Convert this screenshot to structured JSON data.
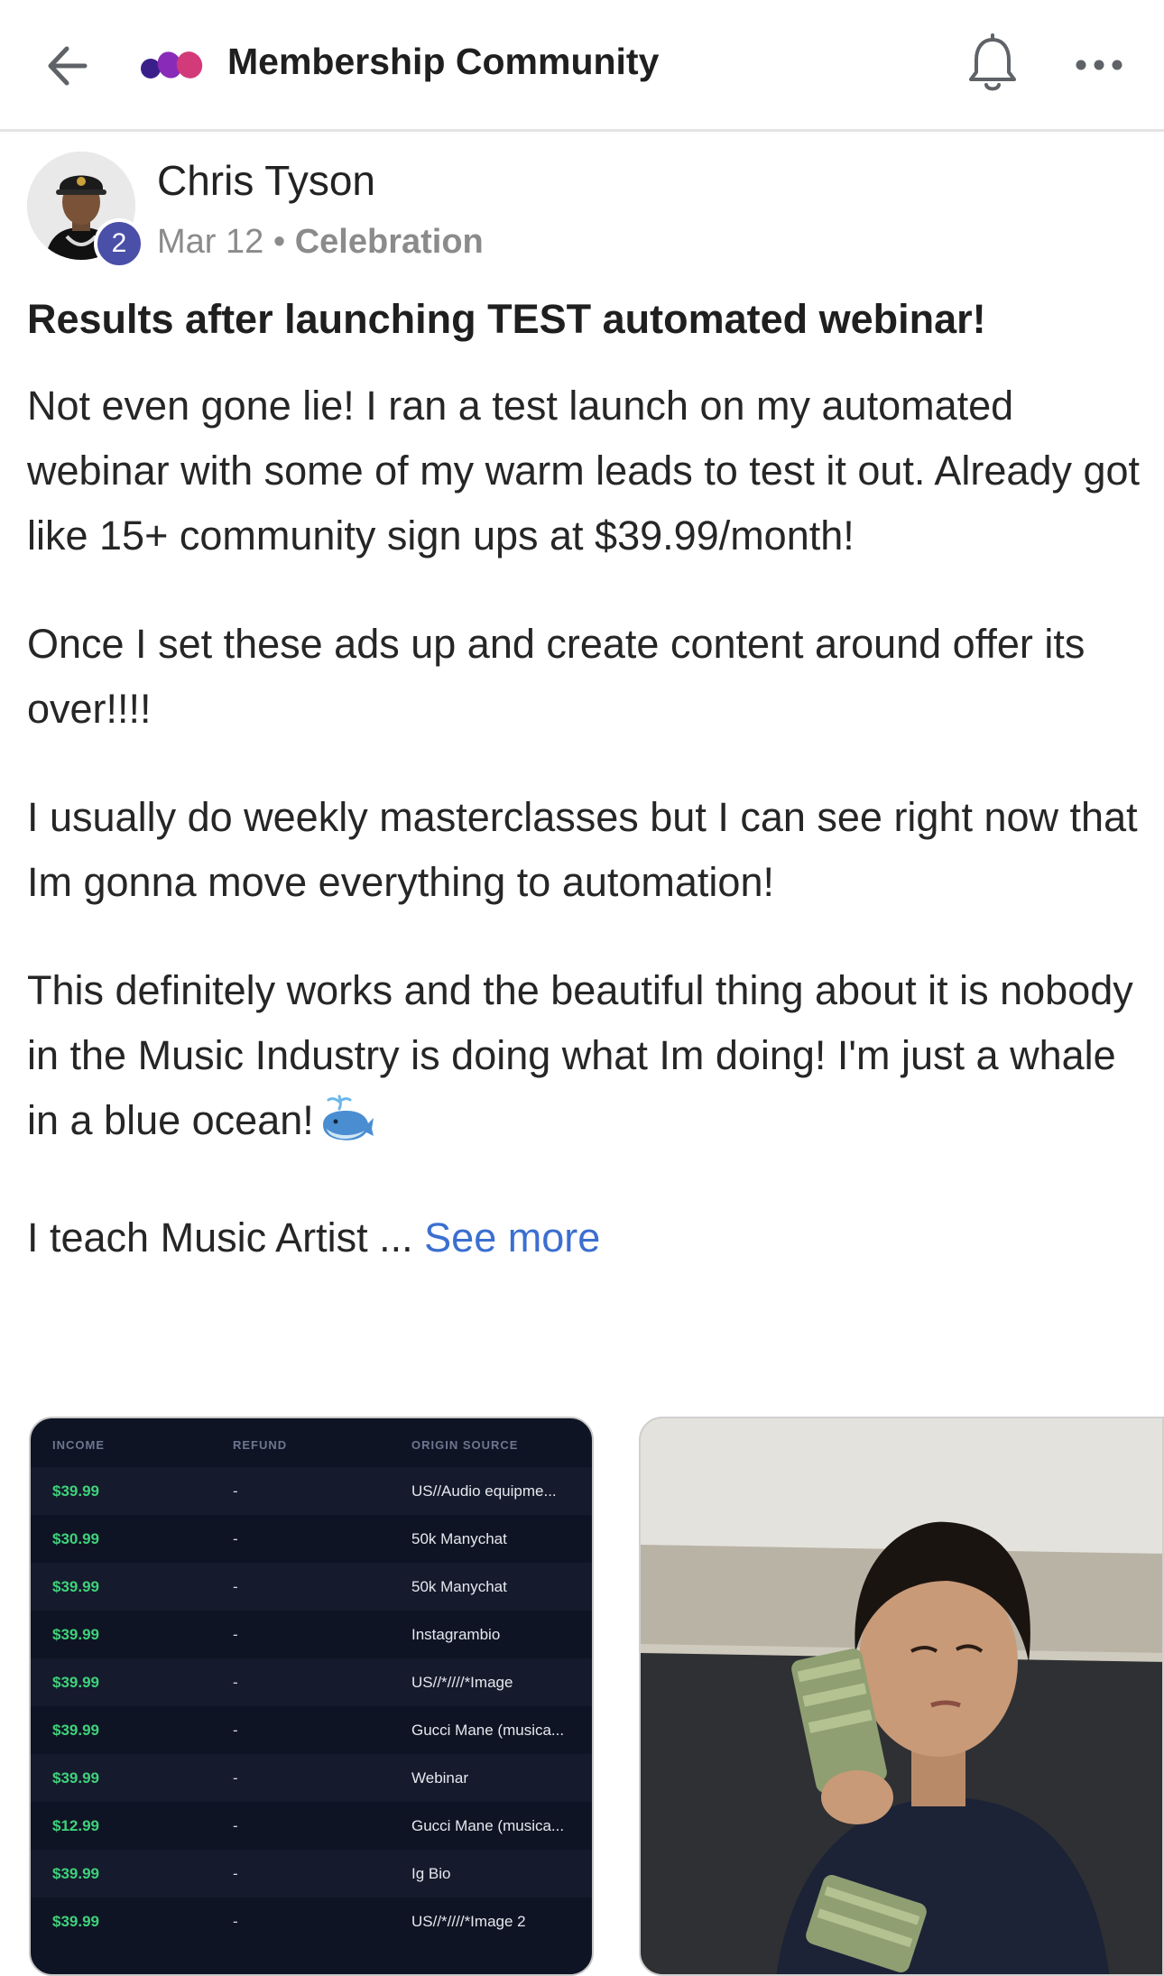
{
  "header": {
    "title": "Membership Community",
    "back_icon": "arrow-left-icon",
    "logo_icon": "membership-logo-icon",
    "bell_icon": "bell-icon",
    "more_icon": "more-horizontal-icon",
    "colors": {
      "logo_dark": "#3a1f8a",
      "logo_mid": "#8a2ab8",
      "logo_light": "#d23a7a"
    }
  },
  "post": {
    "author": "Chris Tyson",
    "level": "2",
    "date": "Mar 12",
    "separator": "•",
    "category": "Celebration",
    "title": "Results after launching TEST automated webinar!",
    "paragraphs": [
      "Not even gone lie! I ran a test launch on my automated webinar with some of my warm leads to test it out. Already got like 15+ community sign ups at $39.99/month!",
      "Once I set these ads up and create content around offer its over!!!!",
      "I usually do weekly masterclasses but I can see right now that Im gonna move everything to automation!",
      "This definitely works and the beautiful thing about it is nobody in the Music Industry is doing what Im doing! I'm just a whale in a blue ocean!"
    ],
    "whale_icon": "whale-emoji-icon",
    "truncated_text": "I teach Music Artist ...",
    "see_more_label": "See more",
    "link_color": "#3b6fd0"
  },
  "attachments": {
    "table": {
      "headers": [
        "INCOME",
        "REFUND",
        "ORIGIN SOURCE"
      ],
      "rows": [
        {
          "income": "$39.99",
          "refund": "-",
          "source": "US//Audio equipme..."
        },
        {
          "income": "$30.99",
          "refund": "-",
          "source": "50k Manychat"
        },
        {
          "income": "$39.99",
          "refund": "-",
          "source": "50k Manychat"
        },
        {
          "income": "$39.99",
          "refund": "-",
          "source": "Instagrambio"
        },
        {
          "income": "$39.99",
          "refund": "-",
          "source": "US//*////*Image"
        },
        {
          "income": "$39.99",
          "refund": "-",
          "source": "Gucci Mane (musica..."
        },
        {
          "income": "$39.99",
          "refund": "-",
          "source": "Webinar"
        },
        {
          "income": "$12.99",
          "refund": "-",
          "source": "Gucci Mane (musica..."
        },
        {
          "income": "$39.99",
          "refund": "-",
          "source": "Ig Bio"
        },
        {
          "income": "$39.99",
          "refund": "-",
          "source": "US//*////*Image 2"
        }
      ]
    },
    "photo_icon": "money-photo-icon"
  }
}
